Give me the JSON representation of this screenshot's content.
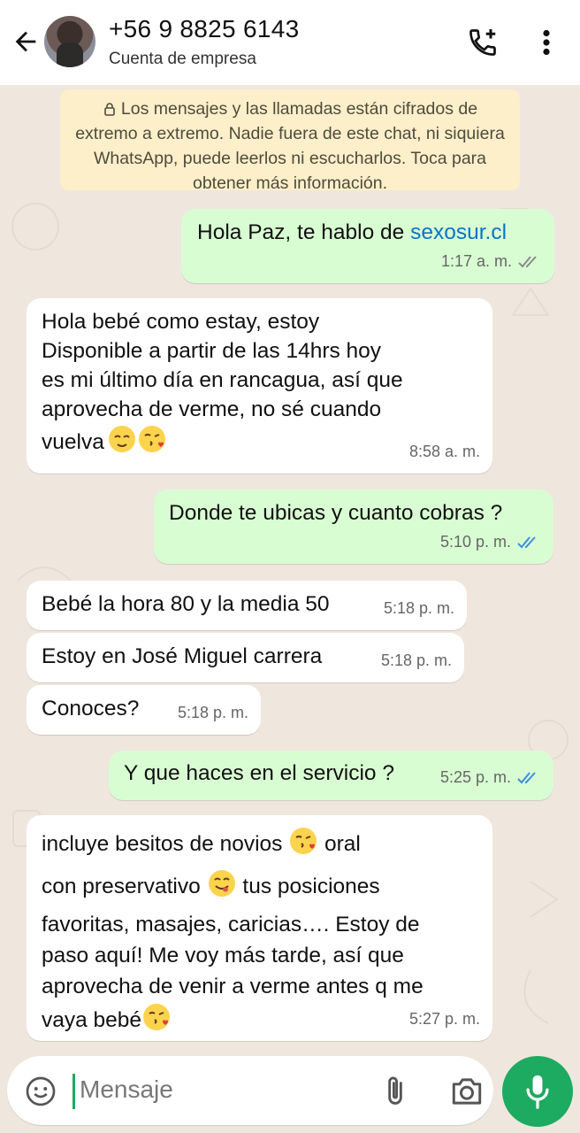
{
  "header": {
    "contact": "+56 9 8825 6143",
    "subtitle": "Cuenta de empresa",
    "icons": [
      "back-arrow-icon",
      "add-call-icon",
      "more-vert-icon"
    ]
  },
  "encryption_notice": "Los mensajes y las llamadas están cifrados de extremo a extremo. Nadie fuera de este chat, ni siquiera WhatsApp, puede leerlos ni escucharlos. Toca para obtener más información.",
  "messages": [
    {
      "dir": "out",
      "text_prefix": "Hola Paz, te hablo de ",
      "link": "sexosur.cl",
      "time": "1:17 a. m.",
      "ticks": "delivered"
    },
    {
      "dir": "in",
      "lines": [
        "Hola bebé como estay, estoy",
        "Disponible a partir de las 14hrs hoy",
        "es mi último día en rancagua, así que",
        "aprovecha de verme, no sé cuando",
        "vuelva"
      ],
      "emojis": [
        "relieved-face",
        "face-blowing-kiss"
      ],
      "time": "8:58 a. m."
    },
    {
      "dir": "out",
      "text": "Donde te ubicas y cuanto cobras ?",
      "time": "5:10 p. m.",
      "ticks": "read"
    },
    {
      "dir": "in",
      "text": "Bebé la hora 80 y la media 50",
      "time": "5:18 p. m."
    },
    {
      "dir": "in",
      "text": "Estoy en José Miguel carrera",
      "time": "5:18 p. m."
    },
    {
      "dir": "in",
      "text": "Conoces?",
      "time": "5:18 p. m."
    },
    {
      "dir": "out",
      "text": "Y que haces en el servicio ?",
      "time": "5:25 p. m.",
      "ticks": "read"
    },
    {
      "dir": "in",
      "lines": [
        "incluye besitos de novios",
        "oral",
        "con preservativo",
        "tus posiciones",
        "favoritas, masajes, caricias…. Estoy de",
        "paso aquí! Me voy más tarde, así que",
        "aprovecha de venir a verme antes q me",
        "vaya bebé"
      ],
      "emojis": [
        "face-blowing-kiss",
        "face-savoring-food",
        "face-blowing-kiss"
      ],
      "time": "5:27 p. m."
    }
  ],
  "composer": {
    "placeholder": "Mensaje",
    "icons": [
      "emoji-icon",
      "attach-icon",
      "camera-icon",
      "mic-icon"
    ]
  },
  "colors": {
    "outgoing_bubble": "#d9fdd3",
    "incoming_bubble": "#ffffff",
    "chat_background": "#efe7de",
    "notice_background": "#fcefc9",
    "link": "#0b73c5",
    "read_ticks": "#3a8fe0",
    "accent": "#1daa61"
  }
}
